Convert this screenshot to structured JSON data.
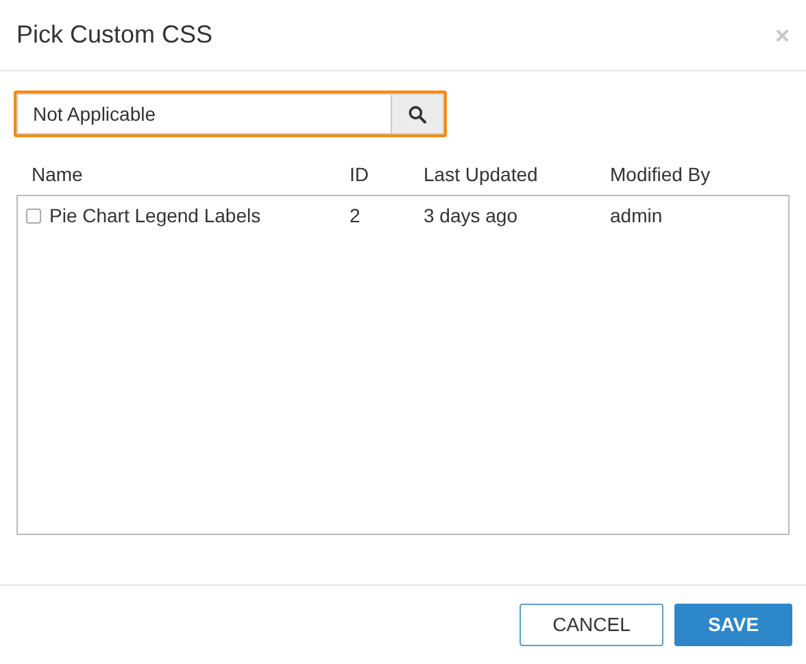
{
  "dialog": {
    "title": "Pick Custom CSS",
    "close": "×"
  },
  "search": {
    "value": "Not Applicable",
    "highlighted": true
  },
  "table": {
    "columns": [
      "Name",
      "ID",
      "Last Updated",
      "Modified By"
    ],
    "rows": [
      {
        "checked": false,
        "cells": [
          "Pie Chart Legend Labels",
          "2",
          "3 days ago",
          "admin"
        ]
      }
    ]
  },
  "buttons": [
    {
      "label": "CANCEL",
      "kind": "secondary"
    },
    {
      "label": "SAVE",
      "kind": "primary"
    }
  ]
}
